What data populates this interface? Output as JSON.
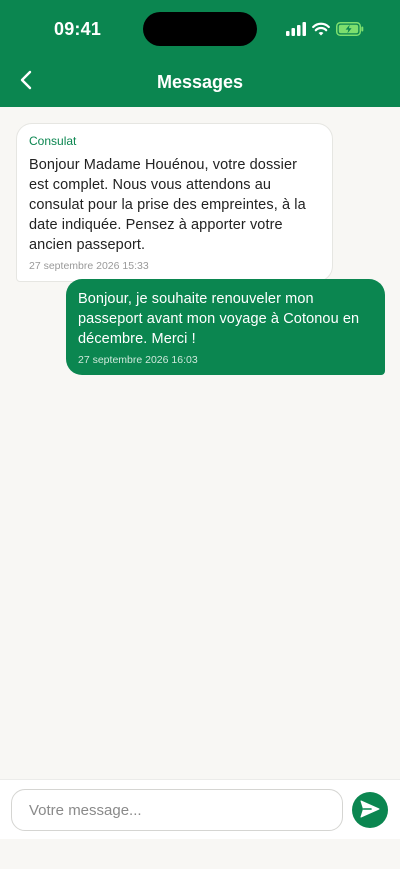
{
  "status_bar": {
    "time": "09:41"
  },
  "header": {
    "title": "Messages",
    "back_icon": "chevron-left-icon"
  },
  "messages": [
    {
      "direction": "incoming",
      "sender": "Consulat",
      "text": "Bonjour Madame Houénou, votre dossier est complet. Nous vous attendons au consulat pour la prise des empreintes, à la date indiquée. Pensez à apporter votre ancien passeport.",
      "timestamp": "27 septembre 2026 15:33"
    },
    {
      "direction": "outgoing",
      "text": "Bonjour, je souhaite renouveler mon passeport avant mon voyage à Cotonou en décembre. Merci !",
      "timestamp": "27 septembre 2026 16:03"
    }
  ],
  "composer": {
    "placeholder": "Votre message...",
    "value": "",
    "send_icon": "send-icon"
  },
  "colors": {
    "brand": "#0b8650",
    "background": "#f8f7f4",
    "incoming_bubble": "#ffffff",
    "outgoing_bubble": "#0b8650"
  }
}
